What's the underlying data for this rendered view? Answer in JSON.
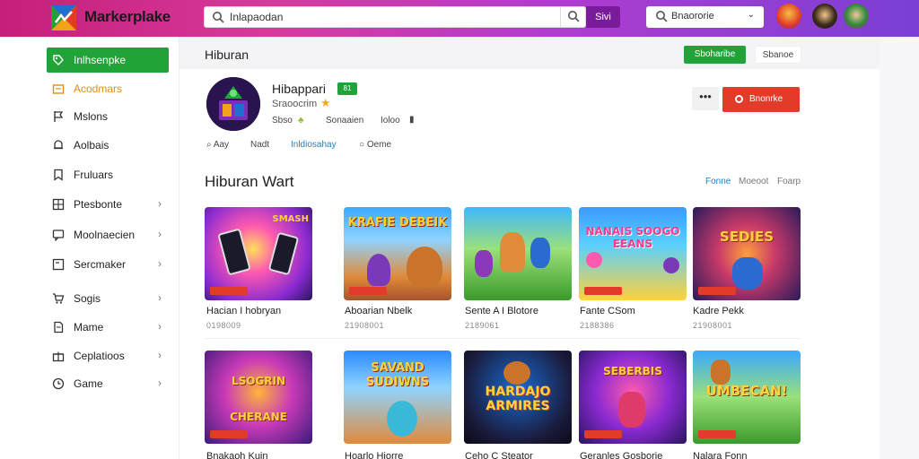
{
  "topbar": {
    "brand": "Markerplake",
    "search_value": "Inlapaodan",
    "search_button": "Sivi",
    "region_value": "Bnaororie",
    "colors": {
      "accent_green": "#22a33a",
      "accent_red": "#e23b2a",
      "link_blue": "#1c7fc9"
    }
  },
  "sidebar": {
    "items": [
      {
        "label": "Inlhsenpke",
        "icon": "tag-icon",
        "state": "active"
      },
      {
        "label": "Acodmars",
        "icon": "folder-icon",
        "state": "highlight"
      },
      {
        "label": "Mslons",
        "icon": "flag-icon"
      },
      {
        "label": "Aolbais",
        "icon": "bell-icon"
      },
      {
        "label": "Fruluars",
        "icon": "bookmark-icon"
      },
      {
        "label": "Ptesbonte",
        "icon": "grid-icon",
        "arrow": "›"
      },
      {
        "label": "Moolnaecien",
        "icon": "chat-icon",
        "arrow": "›"
      },
      {
        "label": "Sercmaker",
        "icon": "box-icon",
        "arrow": "›"
      },
      {
        "label": "Sogis",
        "icon": "cart-icon",
        "arrow": "›"
      },
      {
        "label": "Mame",
        "icon": "doc-icon",
        "arrow": "›"
      },
      {
        "label": "Ceplatioos",
        "icon": "gift-icon",
        "arrow": "›"
      },
      {
        "label": "Game",
        "icon": "clock-icon",
        "arrow": "›"
      }
    ]
  },
  "main": {
    "header_title": "Hiburan",
    "header_btn_primary": "Sboharibe",
    "header_btn_secondary": "Sbanoe",
    "profile": {
      "name": "Hibappari",
      "badge": "81",
      "subtitle": "Sraoocrim",
      "meta": [
        "Sbso",
        "Sonaaien",
        "Ioloo"
      ],
      "more": "•••",
      "follow_label": "Bnonrke"
    },
    "tabs": [
      "Aay",
      "Nadt",
      "Inldiosahay",
      "Oeme"
    ],
    "section_title": "Hiburan Wart",
    "section_links": [
      "Fonne",
      "Moeoot",
      "Foarp"
    ],
    "cards": [
      {
        "title": "Hacian I hobryan",
        "meta": "0198009",
        "art": "SMASH",
        "icon": "phone-game-icon"
      },
      {
        "title": "Aboarian Nbelk",
        "meta": "21908001",
        "art": "KRAFIE DEBEIK",
        "icon": "bear-game-icon"
      },
      {
        "title": "Sente A I Blotore",
        "meta": "2189061",
        "art": "",
        "icon": "adventure-game-icon"
      },
      {
        "title": "Fante CSom",
        "meta": "2188386",
        "art": "NANAIS SOOGO EEANS",
        "icon": "candy-game-icon"
      },
      {
        "title": "Kadre Pekk",
        "meta": "21908001",
        "art": "SEDIES",
        "icon": "space-game-icon"
      },
      {
        "title": "Bnakaoh Kuin",
        "meta": "",
        "art": "LSOGRIN CHERANE",
        "icon": "heroes-game-icon"
      },
      {
        "title": "Hoarlo Hiorre",
        "meta": "",
        "art": "SAVAND SUDIWNS",
        "icon": "monster-game-icon"
      },
      {
        "title": "Ceho C Steator",
        "meta": "",
        "art": "HARDAJO ARMIRES",
        "icon": "bear-racing-icon"
      },
      {
        "title": "Geranles Gosborie",
        "meta": "",
        "art": "SEBERBIS",
        "icon": "magic-game-icon"
      },
      {
        "title": "Nalara Fonn",
        "meta": "",
        "art": "UMBECAN!",
        "icon": "warrior-game-icon"
      }
    ]
  }
}
